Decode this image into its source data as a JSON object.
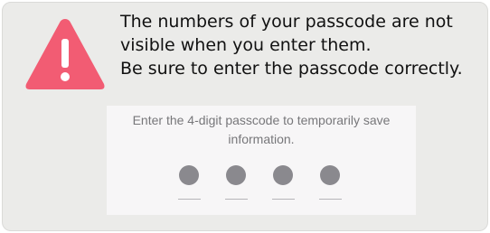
{
  "warning": {
    "icon": "warning-triangle-icon",
    "color": "#f25c73",
    "lines": [
      "The numbers of your passcode are not",
      "visible when you enter them.",
      "Be sure to enter the passcode correctly."
    ]
  },
  "passcode_screen": {
    "prompt_lines": [
      "Enter the 4-digit passcode to temporarily save",
      "information."
    ],
    "digit_count": 4,
    "digits_entered": 4,
    "dot_color": "#8a898e"
  }
}
